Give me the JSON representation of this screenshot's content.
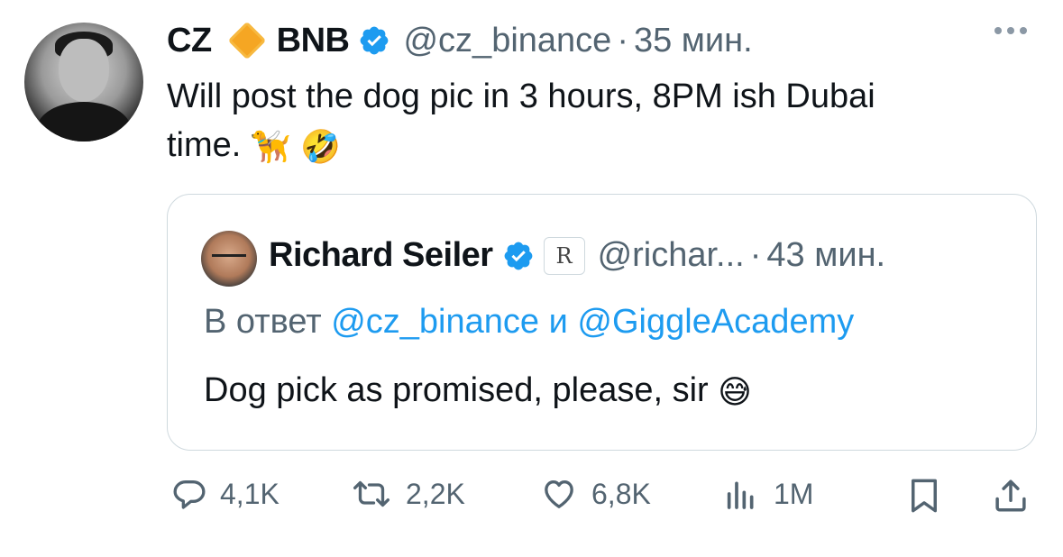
{
  "tweet": {
    "author_name": "CZ",
    "badge_label": "BNB",
    "handle": "@cz_binance",
    "separator": "·",
    "time": "35 мин.",
    "text_line1": "Will post the dog pic in 3 hours, 8PM ish Dubai",
    "text_line2": "time.",
    "emoji_dog": "🦮",
    "emoji_laugh": "🤣"
  },
  "quote": {
    "author_name": "Richard Seiler",
    "badge_letter": "R",
    "handle": "@richar...",
    "separator": "·",
    "time": "43 мин.",
    "reply_prefix": "В ответ",
    "reply_mention1": "@cz_binance",
    "reply_conjunction": "и",
    "reply_mention2": "@GiggleAcademy",
    "text": "Dog pick as promised, please, sir",
    "emoji": "😅"
  },
  "actions": {
    "replies": "4,1K",
    "reposts": "2,2K",
    "likes": "6,8K",
    "views": "1M"
  },
  "colors": {
    "accent": "#1d9bf0",
    "secondary_text": "#536471",
    "border": "#cfd9de",
    "bnb_diamond": "#f5a623"
  },
  "icons": [
    "more-icon",
    "verified-icon",
    "reply-icon",
    "repost-icon",
    "like-icon",
    "views-icon",
    "bookmark-icon",
    "share-icon"
  ]
}
